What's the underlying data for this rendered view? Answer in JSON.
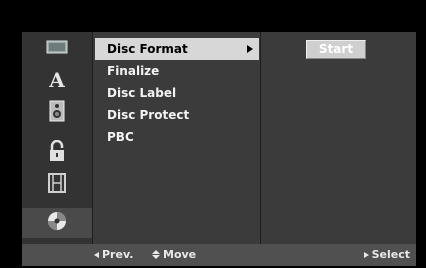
{
  "sidebar": {
    "icons": [
      {
        "name": "picture-icon"
      },
      {
        "name": "language-icon",
        "glyph": "A"
      },
      {
        "name": "audio-speaker-icon"
      },
      {
        "name": "lock-icon"
      },
      {
        "name": "film-icon"
      },
      {
        "name": "disc-icon",
        "selected": true
      }
    ]
  },
  "menu": {
    "items": [
      {
        "label": "Disc Format",
        "active": true
      },
      {
        "label": "Finalize"
      },
      {
        "label": "Disc Label"
      },
      {
        "label": "Disc Protect"
      },
      {
        "label": "PBC"
      }
    ]
  },
  "action": {
    "start_label": "Start"
  },
  "footer": {
    "prev_label": "Prev.",
    "move_label": "Move",
    "select_label": "Select"
  }
}
